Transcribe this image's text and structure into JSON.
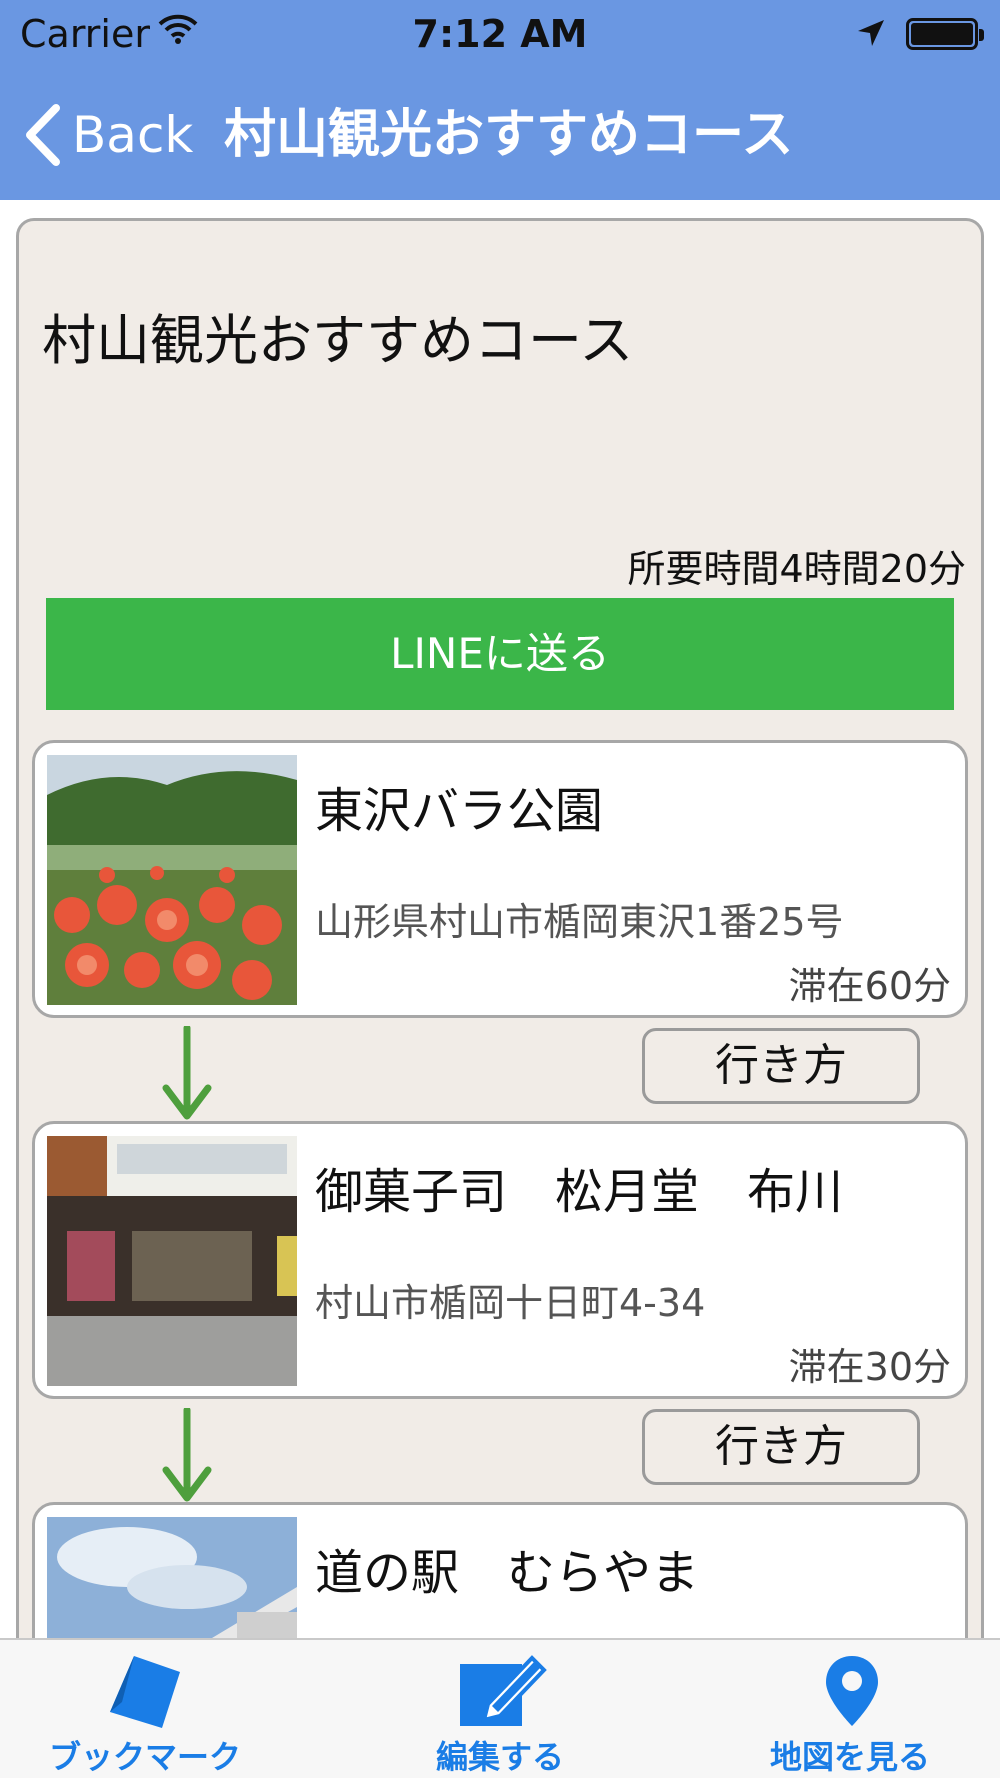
{
  "status_bar": {
    "carrier": "Carrier",
    "time": "7:12 AM"
  },
  "nav": {
    "back_label": "Back",
    "title": "村山観光おすすめコース"
  },
  "course": {
    "title": "村山観光おすすめコース",
    "duration": "所要時間4時間20分",
    "line_button": "LINEに送る"
  },
  "spots": [
    {
      "name": "東沢バラ公園",
      "address": "山形県村山市楯岡東沢1番25号",
      "stay": "滞在60分",
      "route_label": "行き方"
    },
    {
      "name": "御菓子司　松月堂　布川",
      "address": "村山市楯岡十日町4-34",
      "stay": "滞在30分",
      "route_label": "行き方"
    },
    {
      "name": "道の駅　むらやま"
    }
  ],
  "tabbar": {
    "bookmark": "ブックマーク",
    "edit": "編集する",
    "map": "地図を見る"
  },
  "colors": {
    "nav_bar": "#6a97e2",
    "line_green": "#3bb649",
    "arrow_green": "#4e9f3d",
    "tab_blue": "#1a7de6",
    "panel_bg": "#f1ece7"
  }
}
